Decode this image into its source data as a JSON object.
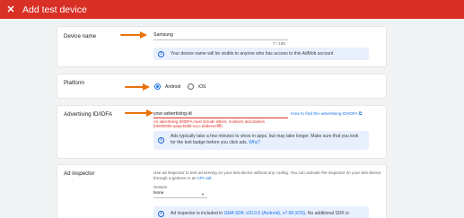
{
  "header": {
    "close_icon": "close-icon",
    "title": "Add test device",
    "color": "#d93025"
  },
  "device_name": {
    "label": "Device name",
    "value": "Samsung",
    "counter": "7 / 100",
    "info": "Your device name will be visible to anyone who has access to this AdMob account"
  },
  "platform": {
    "label": "Platform",
    "options": [
      {
        "label": "Android",
        "selected": true
      },
      {
        "label": "iOS",
        "selected": false
      }
    ]
  },
  "advertising_id": {
    "label": "Advertising ID/IDFA",
    "value": "your-advertising-id",
    "help_link": "How to find the advertising ID/IDFA",
    "error_line1": "An advertising ID/IDFA must include letters, numbers and dashes",
    "error_line2": "(00000000-aaaa-bbbb-cccc-dddeeeeffff)",
    "info_line1": "Ads typically take a few minutes to show in apps, but may take longer. Make sure that you look",
    "info_line2_prefix": "for the test badge before you click ads.",
    "info_line2_link": "Why?"
  },
  "ad_inspector": {
    "label": "Ad inspector",
    "desc_line1": "Use ad inspector to test ad serving on your test device without any coding. You can activate the inspector on your test device",
    "desc_line2_prefix": "through a gesture or an",
    "desc_line2_link": "API call",
    "gesture_label": "Gesture",
    "gesture_value": "None",
    "info_prefix": "Ad inspector is included in",
    "info_link": "GMA SDK v20.0.0 (Android), v7.68 (iOS)",
    "info_suffix": ". No additional SDK is"
  },
  "colors": {
    "accent": "#1a73e8",
    "annotation_arrow": "#e8710a",
    "error": "#d93025",
    "info_background": "#e8f0fe"
  }
}
